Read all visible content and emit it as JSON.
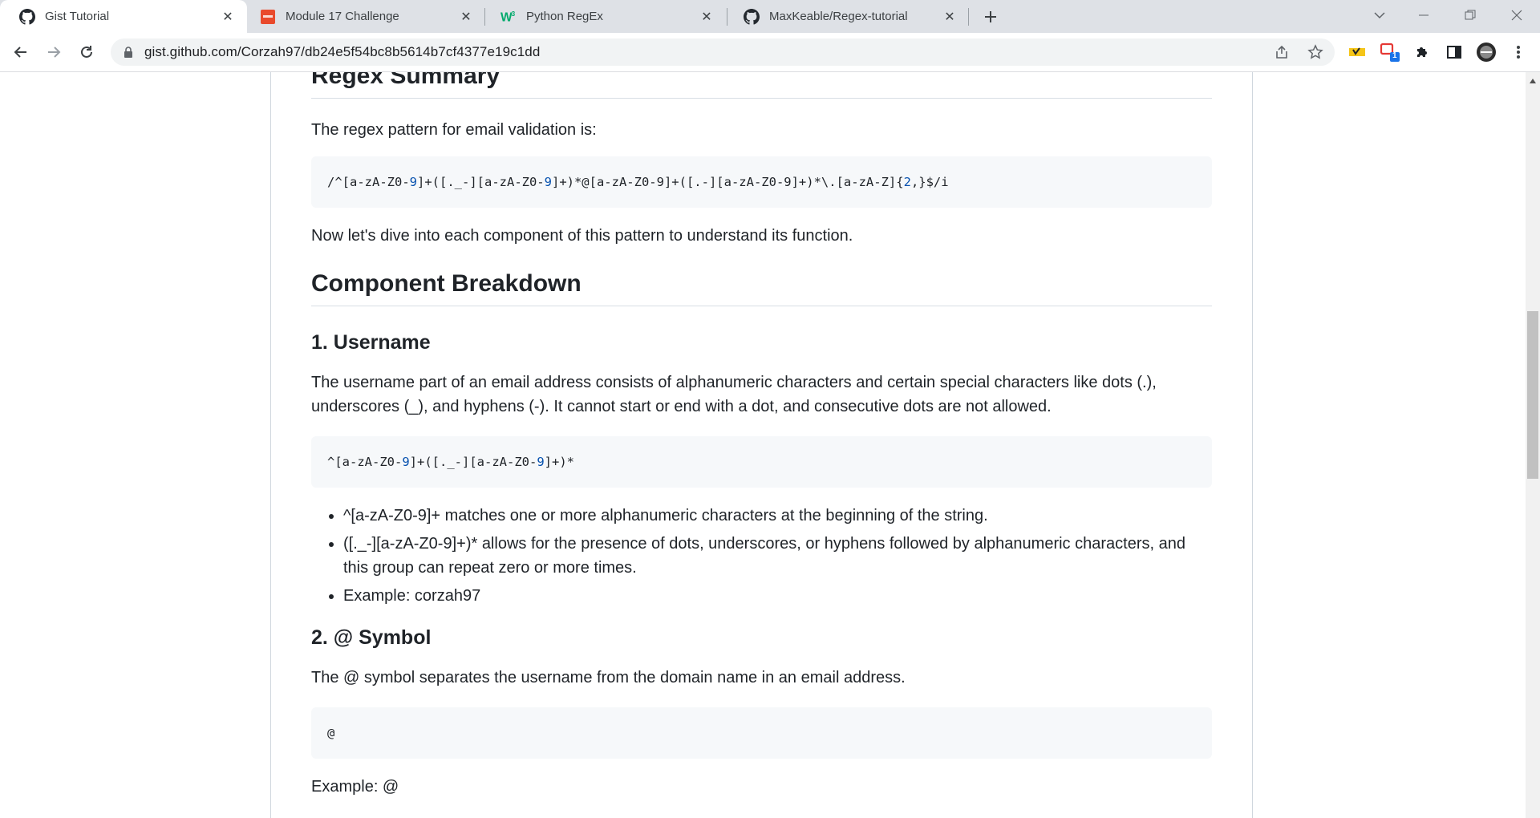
{
  "tabs": [
    {
      "title": "Gist Tutorial",
      "active": true,
      "icon": "github-icon"
    },
    {
      "title": "Module 17 Challenge",
      "active": false,
      "icon": "canvas-icon"
    },
    {
      "title": "Python RegEx",
      "active": false,
      "icon": "w3schools-icon"
    },
    {
      "title": "MaxKeable/Regex-tutorial",
      "active": false,
      "icon": "github-icon"
    }
  ],
  "address_bar": {
    "url": "gist.github.com/Corzah97/db24e5f54bc8b5614b7cf4377e19c1dd"
  },
  "extensions": {
    "badge_count": "1"
  },
  "article": {
    "summary_heading": "Regex Summary",
    "summary_intro": "The regex pattern for email validation is:",
    "full_pattern": {
      "p1": "/^[a-zA-Z0-",
      "n1": "9",
      "p2": "]+([._-][a-zA-Z0-",
      "n2": "9",
      "p3": "]+)*@[a-zA-Z0-9]+([.-][a-zA-Z0-9]+)*\\.[a-zA-Z]{",
      "n3": "2",
      "p4": ",}$/i"
    },
    "dive_text": "Now let's dive into each component of this pattern to understand its function.",
    "breakdown_heading": "Component Breakdown",
    "username": {
      "heading": "1. Username",
      "description": "The username part of an email address consists of alphanumeric characters and certain special characters like dots (.), underscores (_), and hyphens (-). It cannot start or end with a dot, and consecutive dots are not allowed.",
      "code": {
        "p1": "^[a-zA-Z0-",
        "n1": "9",
        "p2": "]+([._-][a-zA-Z0-",
        "n2": "9",
        "p3": "]+)*"
      },
      "bullets": [
        "^[a-zA-Z0-9]+ matches one or more alphanumeric characters at the beginning of the string.",
        "([._-][a-zA-Z0-9]+)* allows for the presence of dots, underscores, or hyphens followed by alphanumeric characters, and this group can repeat zero or more times.",
        "Example: corzah97"
      ]
    },
    "at_symbol": {
      "heading": "2. @ Symbol",
      "description": "The @ symbol separates the username from the domain name in an email address.",
      "code": "@",
      "example": "Example: @"
    }
  },
  "colors": {
    "tabstrip": "#dee1e6",
    "code_background": "#f6f8fa",
    "code_number": "#0550ae",
    "text": "#1f2328"
  }
}
